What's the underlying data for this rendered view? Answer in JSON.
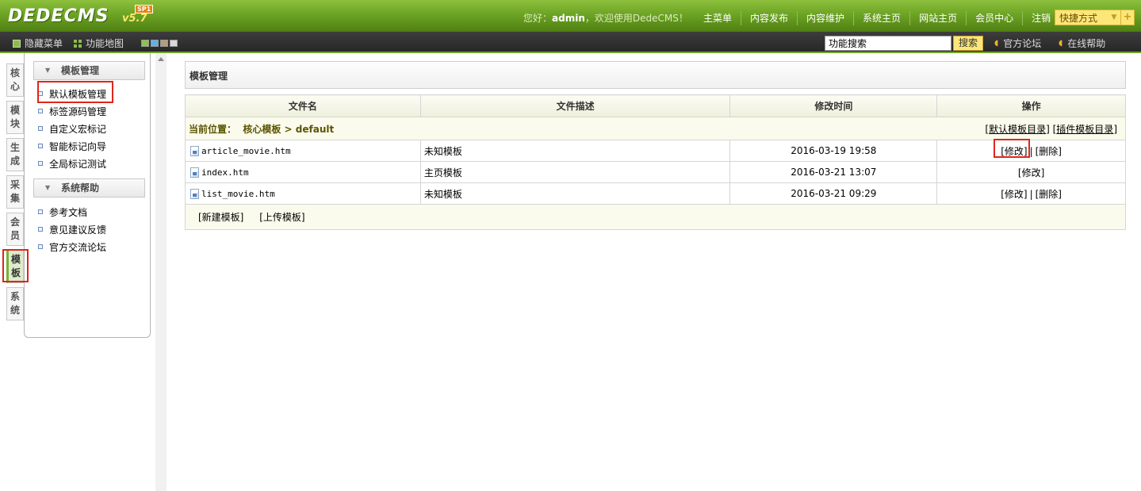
{
  "header": {
    "logo_text": "DEDECMS",
    "logo_version": "v5.7",
    "logo_badge": "SP1",
    "greeting_prefix": "您好：",
    "greeting_user": "admin",
    "greeting_suffix": "，欢迎使用DedeCMS！",
    "nav": [
      "主菜单",
      "内容发布",
      "内容维护",
      "系统主页",
      "网站主页",
      "会员中心",
      "注销"
    ],
    "quick_label": "快捷方式"
  },
  "subbar": {
    "hide_menu": "隐藏菜单",
    "site_map": "功能地图",
    "swatch_colors": [
      "#8bc34a",
      "#5ab4e6",
      "#b89b78",
      "#d9d9d9"
    ],
    "search_value": "功能搜索",
    "search_button": "搜索",
    "forum_link": "官方论坛",
    "help_link": "在线帮助"
  },
  "vtabs": [
    {
      "chars": [
        "核",
        "心"
      ]
    },
    {
      "chars": [
        "模",
        "块"
      ]
    },
    {
      "chars": [
        "生",
        "成"
      ]
    },
    {
      "chars": [
        "采",
        "集"
      ]
    },
    {
      "chars": [
        "会",
        "员"
      ]
    },
    {
      "chars": [
        "模",
        "板"
      ]
    },
    {
      "chars": [
        "系",
        "统"
      ]
    }
  ],
  "menu": {
    "group1_title": "模板管理",
    "group1_items": [
      "默认模板管理",
      "标签源码管理",
      "自定义宏标记",
      "智能标记向导",
      "全局标记测试"
    ],
    "group2_title": "系统帮助",
    "group2_items": [
      "参考文档",
      "意见建议反馈",
      "官方交流论坛"
    ]
  },
  "main": {
    "title": "模板管理",
    "columns": [
      "文件名",
      "文件描述",
      "修改时间",
      "操作"
    ],
    "location_label": "当前位置：",
    "location_path": "核心模板 > default",
    "default_dir_link": "默认模板目录",
    "plugin_dir_link": "插件模板目录",
    "files": [
      {
        "name": "article_movie.htm",
        "desc": "未知模板",
        "mtime": "2016-03-19 19:58",
        "edit": "[修改]",
        "delete": "[删除]"
      },
      {
        "name": "index.htm",
        "desc": "主页模板",
        "mtime": "2016-03-21 13:07",
        "edit": "[修改]",
        "delete": ""
      },
      {
        "name": "list_movie.htm",
        "desc": "未知模板",
        "mtime": "2016-03-21 09:29",
        "edit": "[修改]",
        "delete": "[删除]"
      }
    ],
    "new_template": "[新建模板]",
    "upload_template": "[上传模板]"
  }
}
